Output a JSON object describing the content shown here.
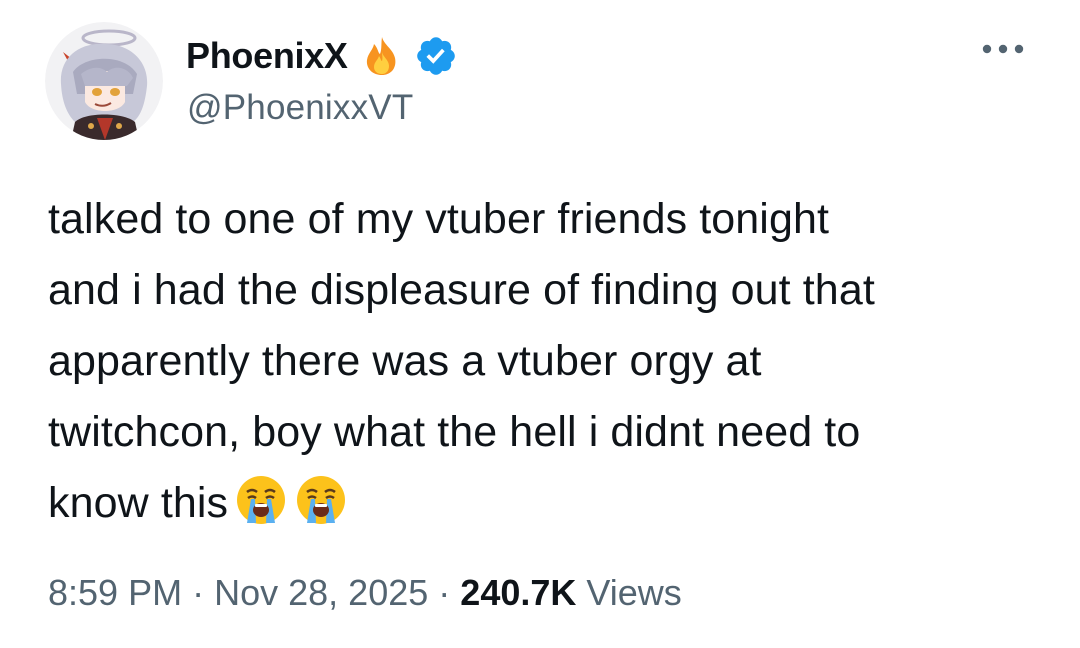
{
  "tweet": {
    "author": {
      "display_name": "PhoenixX",
      "handle": "@PhoenixxVT",
      "badge_icon": "fire-icon",
      "verified_icon": "verified-badge-icon",
      "verified_color": "#1d9bf0"
    },
    "more_icon": "more-options-icon",
    "text_lines": [
      "talked to one of my vtuber friends tonight",
      "and i had the displeasure of finding out that",
      "apparently there was a vtuber orgy at",
      "twitchcon, boy what the hell i didnt need to",
      "know this"
    ],
    "emojis": [
      "loudly-crying-face-icon",
      "loudly-crying-face-icon"
    ],
    "time": "8:59 PM",
    "separator": "·",
    "date": "Nov 28, 2025",
    "views_count": "240.7K",
    "views_label": "Views"
  },
  "colors": {
    "text_primary": "#0f1419",
    "text_secondary": "#536471",
    "accent": "#1d9bf0",
    "background": "#ffffff"
  }
}
